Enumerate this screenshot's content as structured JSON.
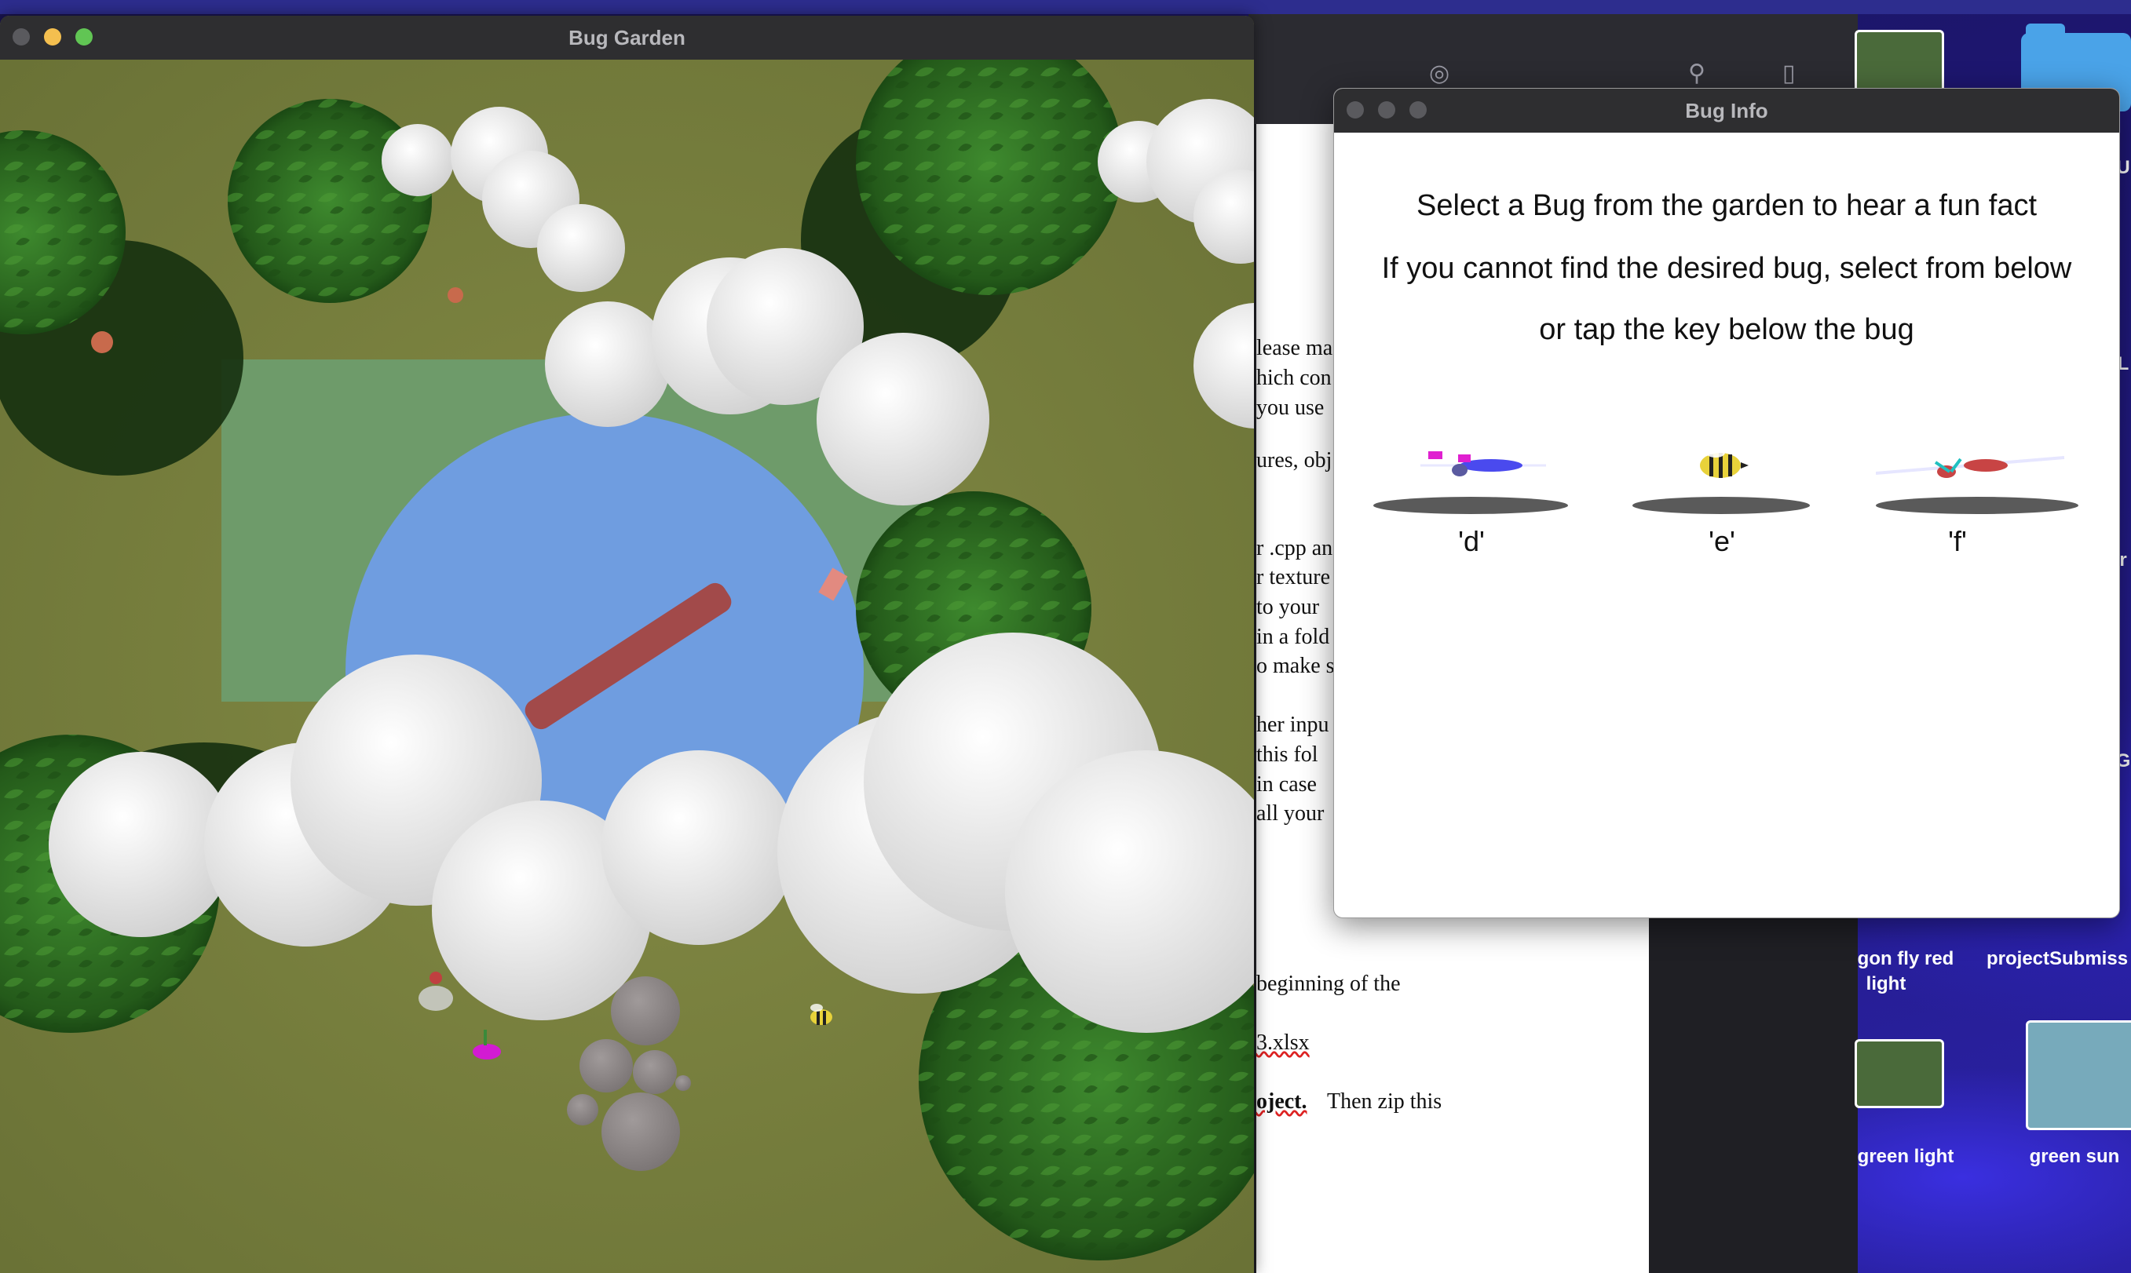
{
  "garden_window": {
    "title": "Bug Garden"
  },
  "info_window": {
    "title": "Bug Info",
    "line1": "Select a Bug from the garden to hear a fun fact",
    "line2": "If you cannot find the desired bug, select from below",
    "line3": "or tap the key below the bug",
    "bugs": [
      {
        "key": "'d'",
        "icon": "dragonfly-blue-icon"
      },
      {
        "key": "'e'",
        "icon": "bee-icon"
      },
      {
        "key": "'f'",
        "icon": "dragonfly-red-icon"
      }
    ]
  },
  "document": {
    "lines": [
      "lease ma",
      "hich con",
      "you use",
      "ures, obj",
      "r .cpp an",
      "r texture",
      "to your",
      "in a fold",
      "o make s",
      "her inpu",
      "this fol",
      "in case",
      "all your",
      "beginning of the",
      "3.xlsx",
      "oject.",
      "Then zip this"
    ]
  },
  "desktop": {
    "labels": [
      "gon fly red",
      "light",
      "projectSubmiss",
      "green light",
      "green sun"
    ],
    "edge_letters": [
      "L",
      "G",
      "U",
      "r"
    ]
  },
  "colors": {
    "grass": "#7c8440",
    "pond": "#6f9de0",
    "cloud": "#e6e6e6",
    "tree": "#2f6a22",
    "log": "#a24a4a",
    "titlebar": "#2e2e30"
  }
}
